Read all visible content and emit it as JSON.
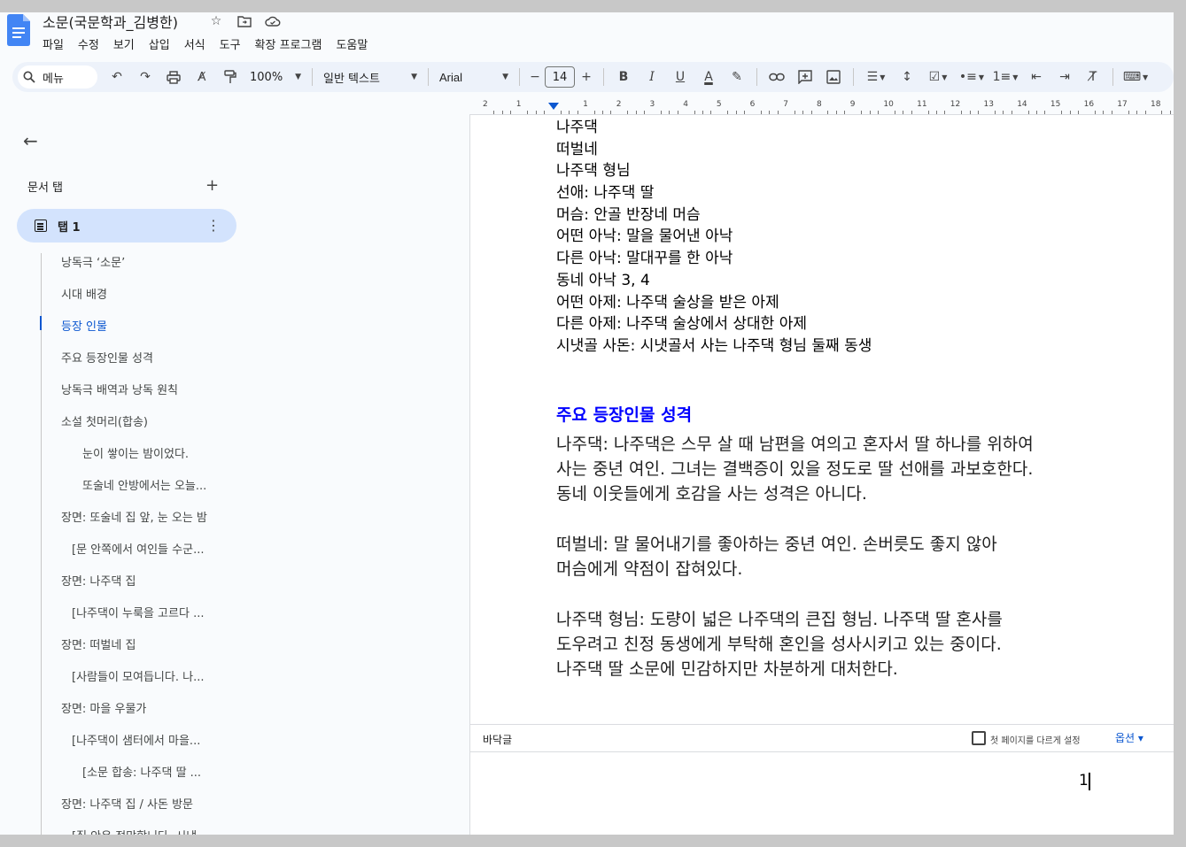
{
  "header": {
    "title": "소문(국문학과_김병한)",
    "menu": [
      "파일",
      "수정",
      "보기",
      "삽입",
      "서식",
      "도구",
      "확장 프로그램",
      "도움말"
    ]
  },
  "toolbar": {
    "search_label": "메뉴",
    "zoom": "100%",
    "style": "일반 텍스트",
    "font": "Arial",
    "font_size": "14"
  },
  "sidebar": {
    "tabs_header": "문서 탭",
    "tab_label": "탭 1",
    "outline": [
      {
        "label": "낭독극 ‘소문’",
        "level": 1
      },
      {
        "label": "시대 배경",
        "level": 1
      },
      {
        "label": "등장 인물",
        "level": 1,
        "active": true
      },
      {
        "label": "주요 등장인물 성격",
        "level": 1
      },
      {
        "label": "낭독극 배역과 낭독 원칙",
        "level": 1
      },
      {
        "label": "소설 첫머리(합송)",
        "level": 1
      },
      {
        "label": "눈이 쌓이는 밤이었다.",
        "level": 3
      },
      {
        "label": "또술네 안방에서는 오늘...",
        "level": 3
      },
      {
        "label": "장면: 또술네 집 앞, 눈 오는 밤",
        "level": 1
      },
      {
        "label": "[문 안쪽에서 여인들 수군...",
        "level": 2
      },
      {
        "label": "장면: 나주댁 집",
        "level": 1
      },
      {
        "label": "[나주댁이 누룩을 고르다 ...",
        "level": 2
      },
      {
        "label": "장면: 떠벌네 집",
        "level": 1
      },
      {
        "label": "[사람들이 모여듭니다. 나...",
        "level": 2
      },
      {
        "label": "장면: 마을 우물가",
        "level": 1
      },
      {
        "label": "[나주댁이 샘터에서 마을...",
        "level": 2
      },
      {
        "label": "[소문 합송: 나주댁 딸 ...",
        "level": 3
      },
      {
        "label": "장면: 나주댁 집 / 사돈 방문",
        "level": 1
      },
      {
        "label": "[집 안은 적막합니다. 시냇...",
        "level": 2
      }
    ]
  },
  "document": {
    "cast_lines": [
      "나주댁",
      "떠벌네",
      "나주댁 형님",
      "선애: 나주댁 딸",
      "머슴: 안골 반장네 머슴",
      "어떤 아낙: 말을 물어낸 아낙",
      "다른 아낙: 말대꾸를 한 아낙",
      "동네 아낙 3, 4",
      "어떤 아제: 나주댁 술상을 받은 아제",
      "다른 아제: 나주댁 술상에서 상대한 아제",
      "시냇골 사돈: 시냇골서 사는 나주댁 형님 둘째 동생"
    ],
    "heading": "주요 등장인물 성격",
    "paragraphs": [
      [
        "나주댁: 나주댁은 스무 살 때 남편을 여의고 혼자서 딸 하나를 위하여",
        "사는 중년 여인. 그녀는 결백증이 있을 정도로 딸 선애를 과보호한다.",
        "동네 이웃들에게 호감을 사는 성격은 아니다."
      ],
      [
        "떠벌네: 말 물어내기를 좋아하는 중년 여인. 손버릇도 좋지 않아",
        "머슴에게 약점이 잡혀있다."
      ],
      [
        "나주댁 형님: 도량이 넓은 나주댁의 큰집 형님. 나주댁 딸 혼사를",
        "도우려고  친정 동생에게 부탁해 혼인을 성사시키고 있는 중이다.",
        "나주댁 딸 소문에 민감하지만 차분하게 대처한다."
      ]
    ],
    "footer_label": "바닥글",
    "footer_checkbox": "첫 페이지를 다르게 설정",
    "footer_options": "옵션 ▾",
    "page_number": "1"
  },
  "colors": {
    "accent": "#0b57d0",
    "heading": "#0000ff",
    "tab_bg": "#d3e3fd",
    "toolbar_bg": "#edf2fa"
  }
}
